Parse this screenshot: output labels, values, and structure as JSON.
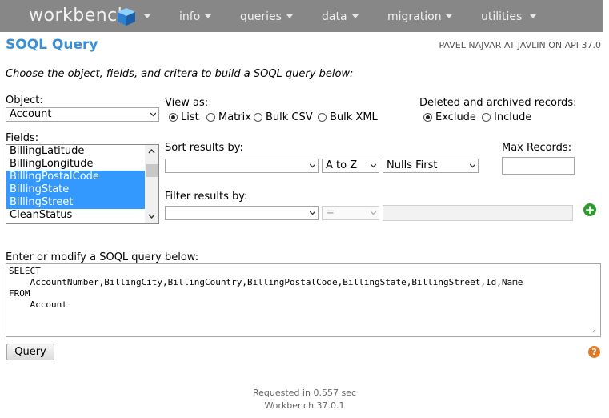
{
  "nav": {
    "logo": "workbench",
    "items": [
      "info",
      "queries",
      "data",
      "migration",
      "utilities"
    ]
  },
  "page": {
    "title": "SOQL Query",
    "user": "PAVEL NAJVAR AT JAVLIN ON API 37.0",
    "intro": "Choose the object, fields, and critera to build a SOQL query below:"
  },
  "object": {
    "label": "Object:",
    "value": "Account"
  },
  "view": {
    "label": "View as:",
    "options": [
      "List",
      "Matrix",
      "Bulk CSV",
      "Bulk XML"
    ],
    "selected": "List"
  },
  "deleted": {
    "label": "Deleted and archived records:",
    "options": [
      "Exclude",
      "Include"
    ],
    "selected": "Exclude"
  },
  "fields": {
    "label": "Fields:",
    "items": [
      "BillingLatitude",
      "BillingLongitude",
      "BillingPostalCode",
      "BillingState",
      "BillingStreet",
      "CleanStatus"
    ],
    "selected": [
      "BillingPostalCode",
      "BillingState",
      "BillingStreet"
    ]
  },
  "sort": {
    "label": "Sort results by:",
    "field": "",
    "direction": "A to Z",
    "nulls": "Nulls First"
  },
  "max_records": {
    "label": "Max Records:",
    "value": ""
  },
  "filter": {
    "label": "Filter results by:",
    "field": "",
    "operator": "=",
    "value": ""
  },
  "query": {
    "label": "Enter or modify a SOQL query below:",
    "text": "SELECT\n    AccountNumber,BillingCity,BillingCountry,BillingPostalCode,BillingState,BillingStreet,Id,Name\nFROM\n    Account"
  },
  "buttons": {
    "query": "Query"
  },
  "footer": {
    "requested": "Requested in 0.557 sec",
    "version": "Workbench 37.0.1"
  },
  "colors": {
    "nav_bg": "#878787",
    "title": "#3a8fd6",
    "selection": "#3399ff",
    "add": "#2e9a2e",
    "help": "#e07a2a"
  }
}
